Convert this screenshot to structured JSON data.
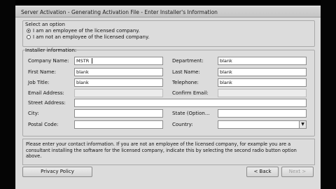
{
  "window": {
    "title": "Server Activation - Generating Activation File - Enter Installer's Information"
  },
  "option_group": {
    "title": "Select an option",
    "options": [
      {
        "label": "I am an employee of the licensed company.",
        "selected": true
      },
      {
        "label": "I am not an employee of the licensed company.",
        "selected": false
      }
    ]
  },
  "installer": {
    "title": "Installer information:",
    "fields": {
      "company_name": {
        "label": "Company Name:",
        "value": "MSTR"
      },
      "department": {
        "label": "Department:",
        "value": "blank"
      },
      "first_name": {
        "label": "First Name:",
        "value": "blank"
      },
      "last_name": {
        "label": "Last Name:",
        "value": "blank"
      },
      "job_title": {
        "label": "Job Title:",
        "value": "blank"
      },
      "telephone": {
        "label": "Telephone:",
        "value": "blank"
      },
      "email": {
        "label": "Email Address:",
        "value": ""
      },
      "confirm_email": {
        "label": "Confirm Email:",
        "value": ""
      },
      "street": {
        "label": "Street Address:",
        "value": ""
      },
      "city": {
        "label": "City:",
        "value": ""
      },
      "state": {
        "label": "State (Option...",
        "value": ""
      },
      "postal": {
        "label": "Postal Code:",
        "value": ""
      },
      "country": {
        "label": "Country:",
        "value": ""
      }
    }
  },
  "info_text": "Please enter your contact information. If you are not an employee of the licensed company, for example you are a consultant installing the software for the licensed company, indicate this by selecting the second radio button option above.",
  "buttons": {
    "privacy": "Privacy Policy",
    "back": "< Back",
    "next": "Next >"
  },
  "colors": {
    "dialog_bg": "#dcdcdc",
    "field_bg": "#ffffff",
    "frame": "#000000"
  }
}
